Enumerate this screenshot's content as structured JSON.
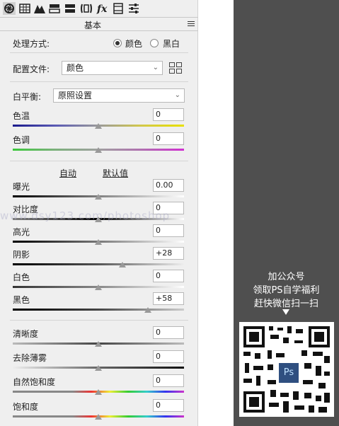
{
  "toolbar": {
    "tools": [
      "aperture-icon",
      "grid-icon",
      "mountain-icon",
      "split-icon",
      "hsl-icon",
      "lens-icon",
      "fx-icon",
      "film-icon",
      "sliders-icon"
    ]
  },
  "section": {
    "title": "基本"
  },
  "processing": {
    "label": "处理方式:",
    "option_color": "颜色",
    "option_bw": "黑白",
    "selected": "颜色"
  },
  "profile": {
    "label": "配置文件:",
    "value": "颜色"
  },
  "white_balance": {
    "label": "白平衡:",
    "value": "原照设置"
  },
  "temperature": {
    "label": "色温",
    "value": "0",
    "position": 0.5
  },
  "tint": {
    "label": "色调",
    "value": "0",
    "position": 0.5
  },
  "auto_label": "自动",
  "default_label": "默认值",
  "exposure": {
    "label": "曝光",
    "value": "0.00",
    "position": 0.5
  },
  "contrast": {
    "label": "对比度",
    "value": "0",
    "position": 0.5
  },
  "highlights": {
    "label": "高光",
    "value": "0",
    "position": 0.5
  },
  "shadows": {
    "label": "阴影",
    "value": "+28",
    "position": 0.64
  },
  "whites": {
    "label": "白色",
    "value": "0",
    "position": 0.5
  },
  "blacks": {
    "label": "黑色",
    "value": "+58",
    "position": 0.79
  },
  "clarity": {
    "label": "清晰度",
    "value": "0",
    "position": 0.5
  },
  "dehaze": {
    "label": "去除薄雾",
    "value": "0",
    "position": 0.5
  },
  "vibrance": {
    "label": "自然饱和度",
    "value": "0",
    "position": 0.5
  },
  "saturation": {
    "label": "饱和度",
    "value": "0",
    "position": 0.5
  },
  "promo": {
    "line1": "加公众号",
    "line2": "领取PS自学福利",
    "line3": "赶快微信扫一扫",
    "logo": "Ps"
  },
  "watermark": "www.dsy123.com/photoshop",
  "colors": {
    "panel_bg": "#efefef",
    "promo_bg": "#4f4f4f"
  }
}
